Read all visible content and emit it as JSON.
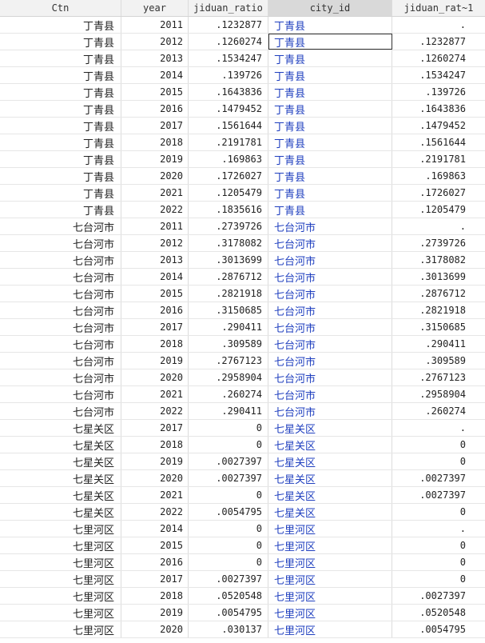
{
  "headers": [
    "Ctn",
    "year",
    "jiduan_ratio",
    "city_id",
    "jiduan_rat~1"
  ],
  "rows": [
    [
      "丁青县",
      "2011",
      ".1232877",
      "丁青县",
      "."
    ],
    [
      "丁青县",
      "2012",
      ".1260274",
      "丁青县",
      ".1232877"
    ],
    [
      "丁青县",
      "2013",
      ".1534247",
      "丁青县",
      ".1260274"
    ],
    [
      "丁青县",
      "2014",
      ".139726",
      "丁青县",
      ".1534247"
    ],
    [
      "丁青县",
      "2015",
      ".1643836",
      "丁青县",
      ".139726"
    ],
    [
      "丁青县",
      "2016",
      ".1479452",
      "丁青县",
      ".1643836"
    ],
    [
      "丁青县",
      "2017",
      ".1561644",
      "丁青县",
      ".1479452"
    ],
    [
      "丁青县",
      "2018",
      ".2191781",
      "丁青县",
      ".1561644"
    ],
    [
      "丁青县",
      "2019",
      ".169863",
      "丁青县",
      ".2191781"
    ],
    [
      "丁青县",
      "2020",
      ".1726027",
      "丁青县",
      ".169863"
    ],
    [
      "丁青县",
      "2021",
      ".1205479",
      "丁青县",
      ".1726027"
    ],
    [
      "丁青县",
      "2022",
      ".1835616",
      "丁青县",
      ".1205479"
    ],
    [
      "七台河市",
      "2011",
      ".2739726",
      "七台河市",
      "."
    ],
    [
      "七台河市",
      "2012",
      ".3178082",
      "七台河市",
      ".2739726"
    ],
    [
      "七台河市",
      "2013",
      ".3013699",
      "七台河市",
      ".3178082"
    ],
    [
      "七台河市",
      "2014",
      ".2876712",
      "七台河市",
      ".3013699"
    ],
    [
      "七台河市",
      "2015",
      ".2821918",
      "七台河市",
      ".2876712"
    ],
    [
      "七台河市",
      "2016",
      ".3150685",
      "七台河市",
      ".2821918"
    ],
    [
      "七台河市",
      "2017",
      ".290411",
      "七台河市",
      ".3150685"
    ],
    [
      "七台河市",
      "2018",
      ".309589",
      "七台河市",
      ".290411"
    ],
    [
      "七台河市",
      "2019",
      ".2767123",
      "七台河市",
      ".309589"
    ],
    [
      "七台河市",
      "2020",
      ".2958904",
      "七台河市",
      ".2767123"
    ],
    [
      "七台河市",
      "2021",
      ".260274",
      "七台河市",
      ".2958904"
    ],
    [
      "七台河市",
      "2022",
      ".290411",
      "七台河市",
      ".260274"
    ],
    [
      "七星关区",
      "2017",
      "0",
      "七星关区",
      "."
    ],
    [
      "七星关区",
      "2018",
      "0",
      "七星关区",
      "0"
    ],
    [
      "七星关区",
      "2019",
      ".0027397",
      "七星关区",
      "0"
    ],
    [
      "七星关区",
      "2020",
      ".0027397",
      "七星关区",
      ".0027397"
    ],
    [
      "七星关区",
      "2021",
      "0",
      "七星关区",
      ".0027397"
    ],
    [
      "七星关区",
      "2022",
      ".0054795",
      "七星关区",
      "0"
    ],
    [
      "七里河区",
      "2014",
      "0",
      "七里河区",
      "."
    ],
    [
      "七里河区",
      "2015",
      "0",
      "七里河区",
      "0"
    ],
    [
      "七里河区",
      "2016",
      "0",
      "七里河区",
      "0"
    ],
    [
      "七里河区",
      "2017",
      ".0027397",
      "七里河区",
      "0"
    ],
    [
      "七里河区",
      "2018",
      ".0520548",
      "七里河区",
      ".0027397"
    ],
    [
      "七里河区",
      "2019",
      ".0054795",
      "七里河区",
      ".0520548"
    ],
    [
      "七里河区",
      "2020",
      ".030137",
      "七里河区",
      ".0054795"
    ]
  ],
  "colors": {
    "header_bg": "#f2f2f2",
    "selected_header_bg": "#d9d9d9",
    "string_text": "#1f3fbf",
    "numeric_text": "#222222",
    "grid_line": "#dcdcdc"
  }
}
